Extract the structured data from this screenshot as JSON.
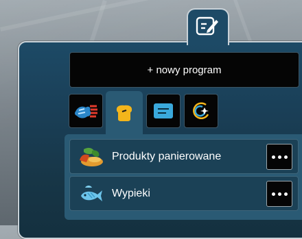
{
  "toolbar": {
    "edit_icon": "edit-icon"
  },
  "new_program": {
    "label": "+ nowy program"
  },
  "categories": [
    {
      "icon": "meat-fish-category-icon",
      "active": false
    },
    {
      "icon": "bread-category-icon",
      "active": true,
      "color": "#f3b51b"
    },
    {
      "icon": "tray-category-icon",
      "active": false,
      "color": "#3aa9dc"
    },
    {
      "icon": "special-program-icon",
      "active": false
    }
  ],
  "programs": [
    {
      "label": "Produkty panierowane",
      "icon": "breaded-products-icon"
    },
    {
      "label": "Wypieki",
      "icon": "fish-icon"
    }
  ],
  "colors": {
    "panel": "#1d4a66",
    "active_tab": "#2a5a74",
    "accent_yellow": "#f3b51b",
    "accent_blue": "#3aa9dc"
  }
}
